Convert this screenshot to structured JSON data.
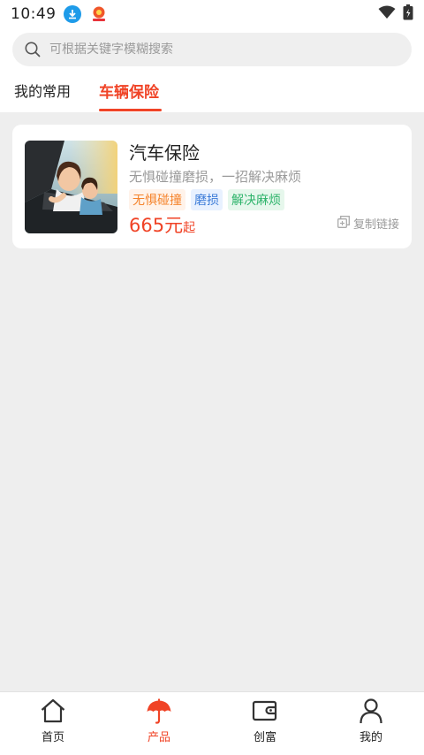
{
  "status_bar": {
    "time": "10:49"
  },
  "search": {
    "placeholder": "可根据关键字模糊搜索"
  },
  "tabs": [
    {
      "label": "我的常用",
      "active": false
    },
    {
      "label": "车辆保险",
      "active": true
    }
  ],
  "product": {
    "title": "汽车保险",
    "subtitle": "无惧碰撞磨损，一招解决麻烦",
    "tags": [
      "无惧碰撞",
      "磨损",
      "解决麻烦"
    ],
    "price": "665元",
    "price_suffix": "起",
    "copy_label": "复制链接"
  },
  "bottom_nav": [
    {
      "label": "首页",
      "icon": "home-icon"
    },
    {
      "label": "产品",
      "icon": "umbrella-icon",
      "active": true
    },
    {
      "label": "创富",
      "icon": "wallet-icon"
    },
    {
      "label": "我的",
      "icon": "user-icon"
    }
  ],
  "colors": {
    "accent": "#f04326",
    "background": "#eeeeee"
  }
}
